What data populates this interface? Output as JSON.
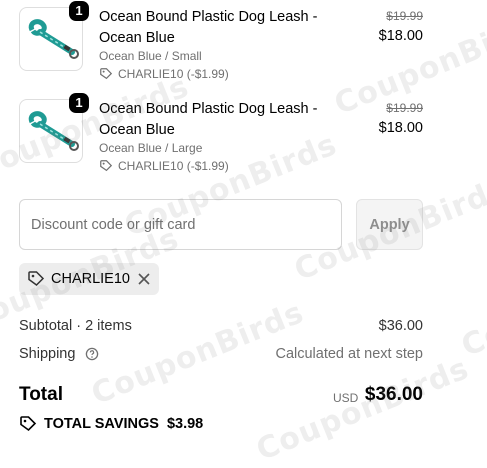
{
  "items": [
    {
      "quantity": "1",
      "title": "Ocean Bound Plastic Dog Leash - Ocean Blue",
      "variant": "Ocean Blue / Small",
      "discount": "CHARLIE10 (-$1.99)",
      "original_price": "$19.99",
      "price": "$18.00",
      "thumb_color": "#1f9b94"
    },
    {
      "quantity": "1",
      "title": "Ocean Bound Plastic Dog Leash - Ocean Blue",
      "variant": "Ocean Blue / Large",
      "discount": "CHARLIE10 (-$1.99)",
      "original_price": "$19.99",
      "price": "$18.00",
      "thumb_color": "#1f9b94"
    }
  ],
  "discount_field": {
    "placeholder": "Discount code or gift card",
    "value": ""
  },
  "apply_button": {
    "label": "Apply"
  },
  "applied_code": {
    "code": "CHARLIE10"
  },
  "summary": {
    "subtotal_label": "Subtotal · 2 items",
    "subtotal_value": "$36.00",
    "shipping_label": "Shipping",
    "shipping_value": "Calculated at next step",
    "total_label": "Total",
    "currency": "USD",
    "total_value": "$36.00",
    "savings_label": "TOTAL SAVINGS",
    "savings_value": "$3.98"
  },
  "watermark": "CouponBirds"
}
